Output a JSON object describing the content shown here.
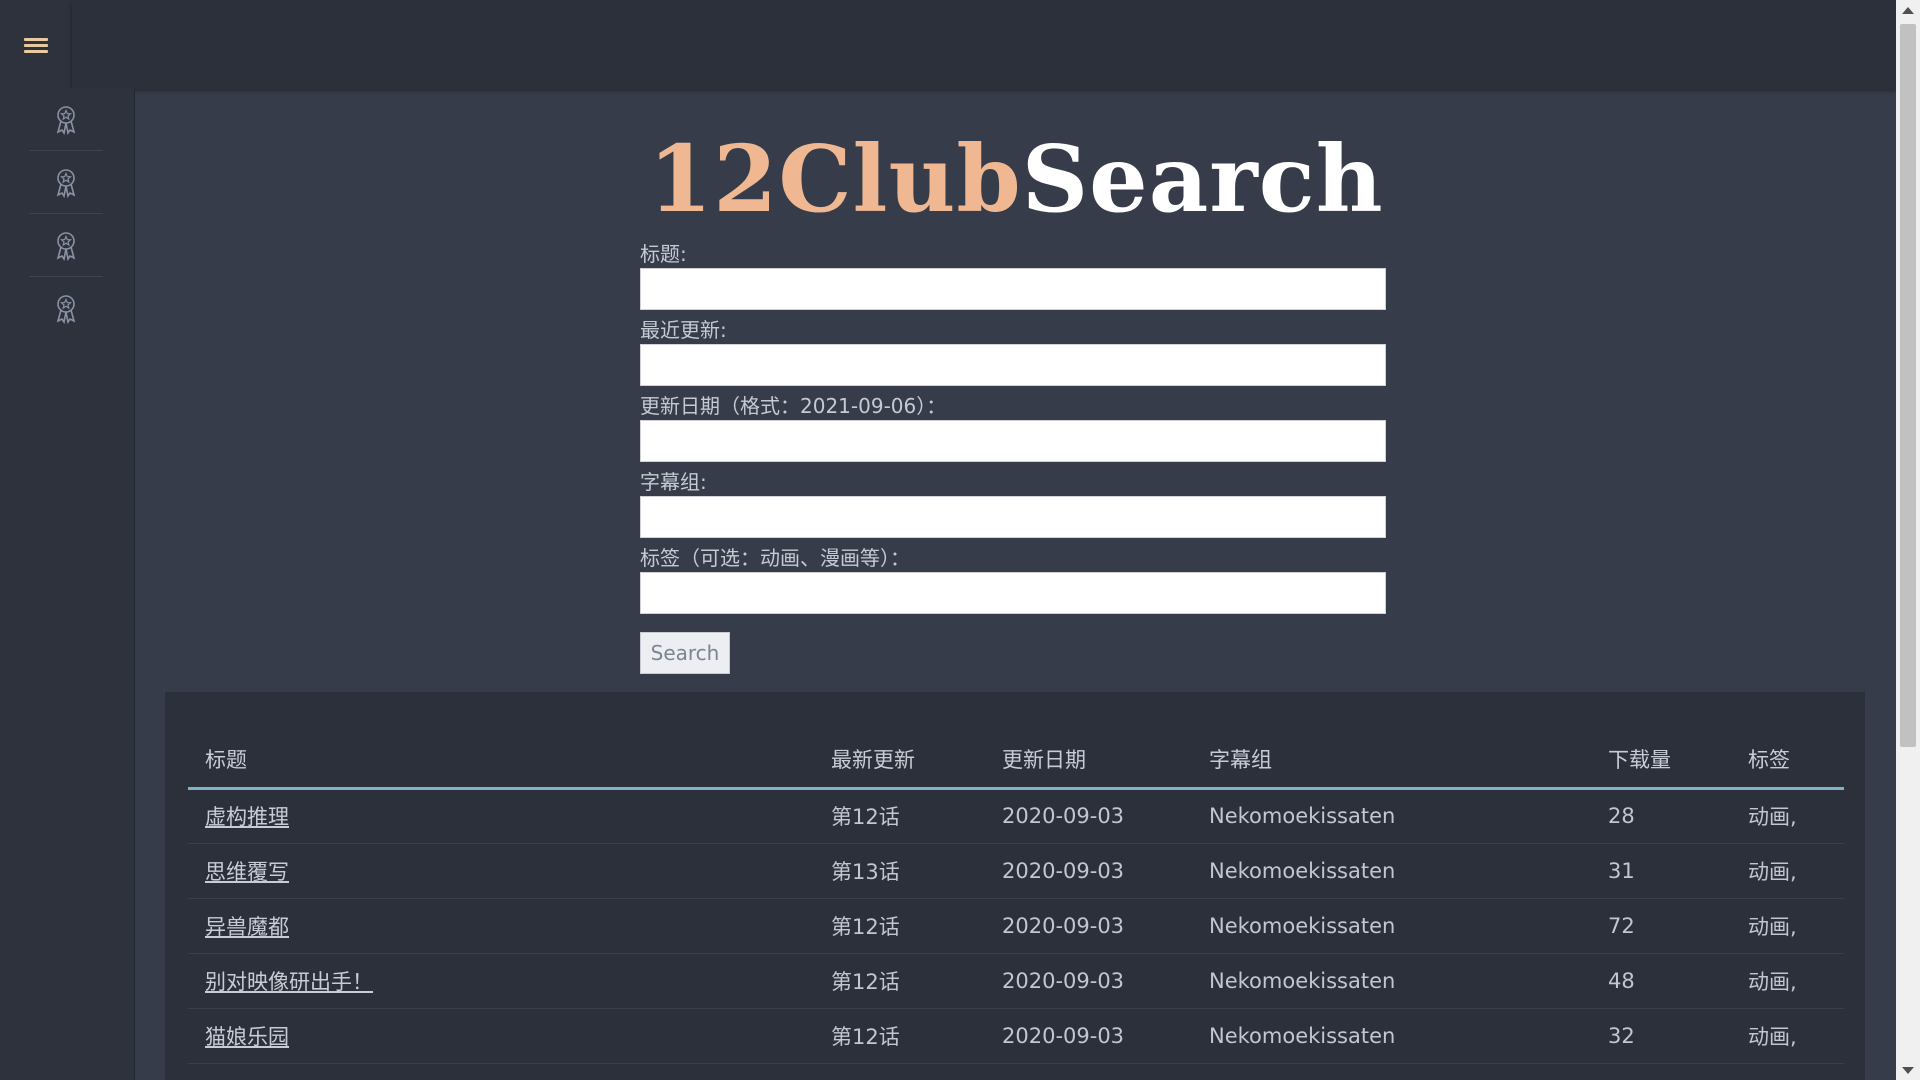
{
  "app": {
    "logo_part1": "12Club",
    "logo_part2": "Search",
    "accent_color": "#efb892"
  },
  "navigation": {
    "menu_icon": "hamburger-menu-icon",
    "sidebar_items": [
      {
        "icon": "award-ribbon-icon"
      },
      {
        "icon": "award-ribbon-icon"
      },
      {
        "icon": "award-ribbon-icon"
      },
      {
        "icon": "award-ribbon-icon"
      }
    ]
  },
  "form": {
    "title_label": "标题:",
    "title_value": "",
    "latest_label": "最近更新:",
    "latest_value": "",
    "date_label": "更新日期（格式：2021-09-06）：",
    "date_value": "",
    "group_label": "字幕组:",
    "group_value": "",
    "tags_label": "标签（可选：动画、漫画等）：",
    "tags_value": "",
    "search_button": "Search"
  },
  "results": {
    "columns": [
      "标题",
      "最新更新",
      "更新日期",
      "字幕组",
      "下载量",
      "标签"
    ],
    "rows": [
      {
        "title": "虚构推理",
        "latest": "第12话",
        "date": "2020-09-03",
        "group": "Nekomoekissaten",
        "downloads": "28",
        "tags": "动画,"
      },
      {
        "title": "思维覆写",
        "latest": "第13话",
        "date": "2020-09-03",
        "group": "Nekomoekissaten",
        "downloads": "31",
        "tags": "动画,"
      },
      {
        "title": "异兽魔都",
        "latest": "第12话",
        "date": "2020-09-03",
        "group": "Nekomoekissaten",
        "downloads": "72",
        "tags": "动画,"
      },
      {
        "title": "别对映像研出手！",
        "latest": "第12话",
        "date": "2020-09-03",
        "group": "Nekomoekissaten",
        "downloads": "48",
        "tags": "动画,"
      },
      {
        "title": "猫娘乐园",
        "latest": "第12话",
        "date": "2020-09-03",
        "group": "Nekomoekissaten",
        "downloads": "32",
        "tags": "动画,"
      }
    ],
    "header_underline_color": "#7fb2c8"
  }
}
